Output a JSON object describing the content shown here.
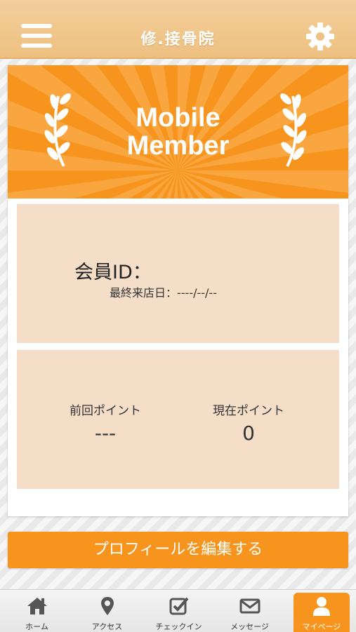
{
  "header": {
    "title": "修.接骨院",
    "menu_icon": "hamburger-menu-icon",
    "settings_icon": "gear-icon"
  },
  "banner": {
    "line1": "Mobile",
    "line2": "Member",
    "colors": {
      "accent": "#f7941d",
      "ray": "#f9a641"
    }
  },
  "member": {
    "id_label": "会員ID：",
    "last_visit_label": "最終来店日：----/--/--"
  },
  "points": {
    "previous_label": "前回ポイント",
    "previous_value": "---",
    "current_label": "現在ポイント",
    "current_value": "0"
  },
  "edit_profile_label": "プロフィールを編集する",
  "tabs": [
    {
      "label": "ホーム",
      "icon": "home-icon",
      "active": false
    },
    {
      "label": "アクセス",
      "icon": "map-pin-icon",
      "active": false
    },
    {
      "label": "チェックイン",
      "icon": "checkbox-icon",
      "active": false
    },
    {
      "label": "メッセージ",
      "icon": "envelope-icon",
      "active": false
    },
    {
      "label": "マイページ",
      "icon": "user-icon",
      "active": true
    }
  ]
}
